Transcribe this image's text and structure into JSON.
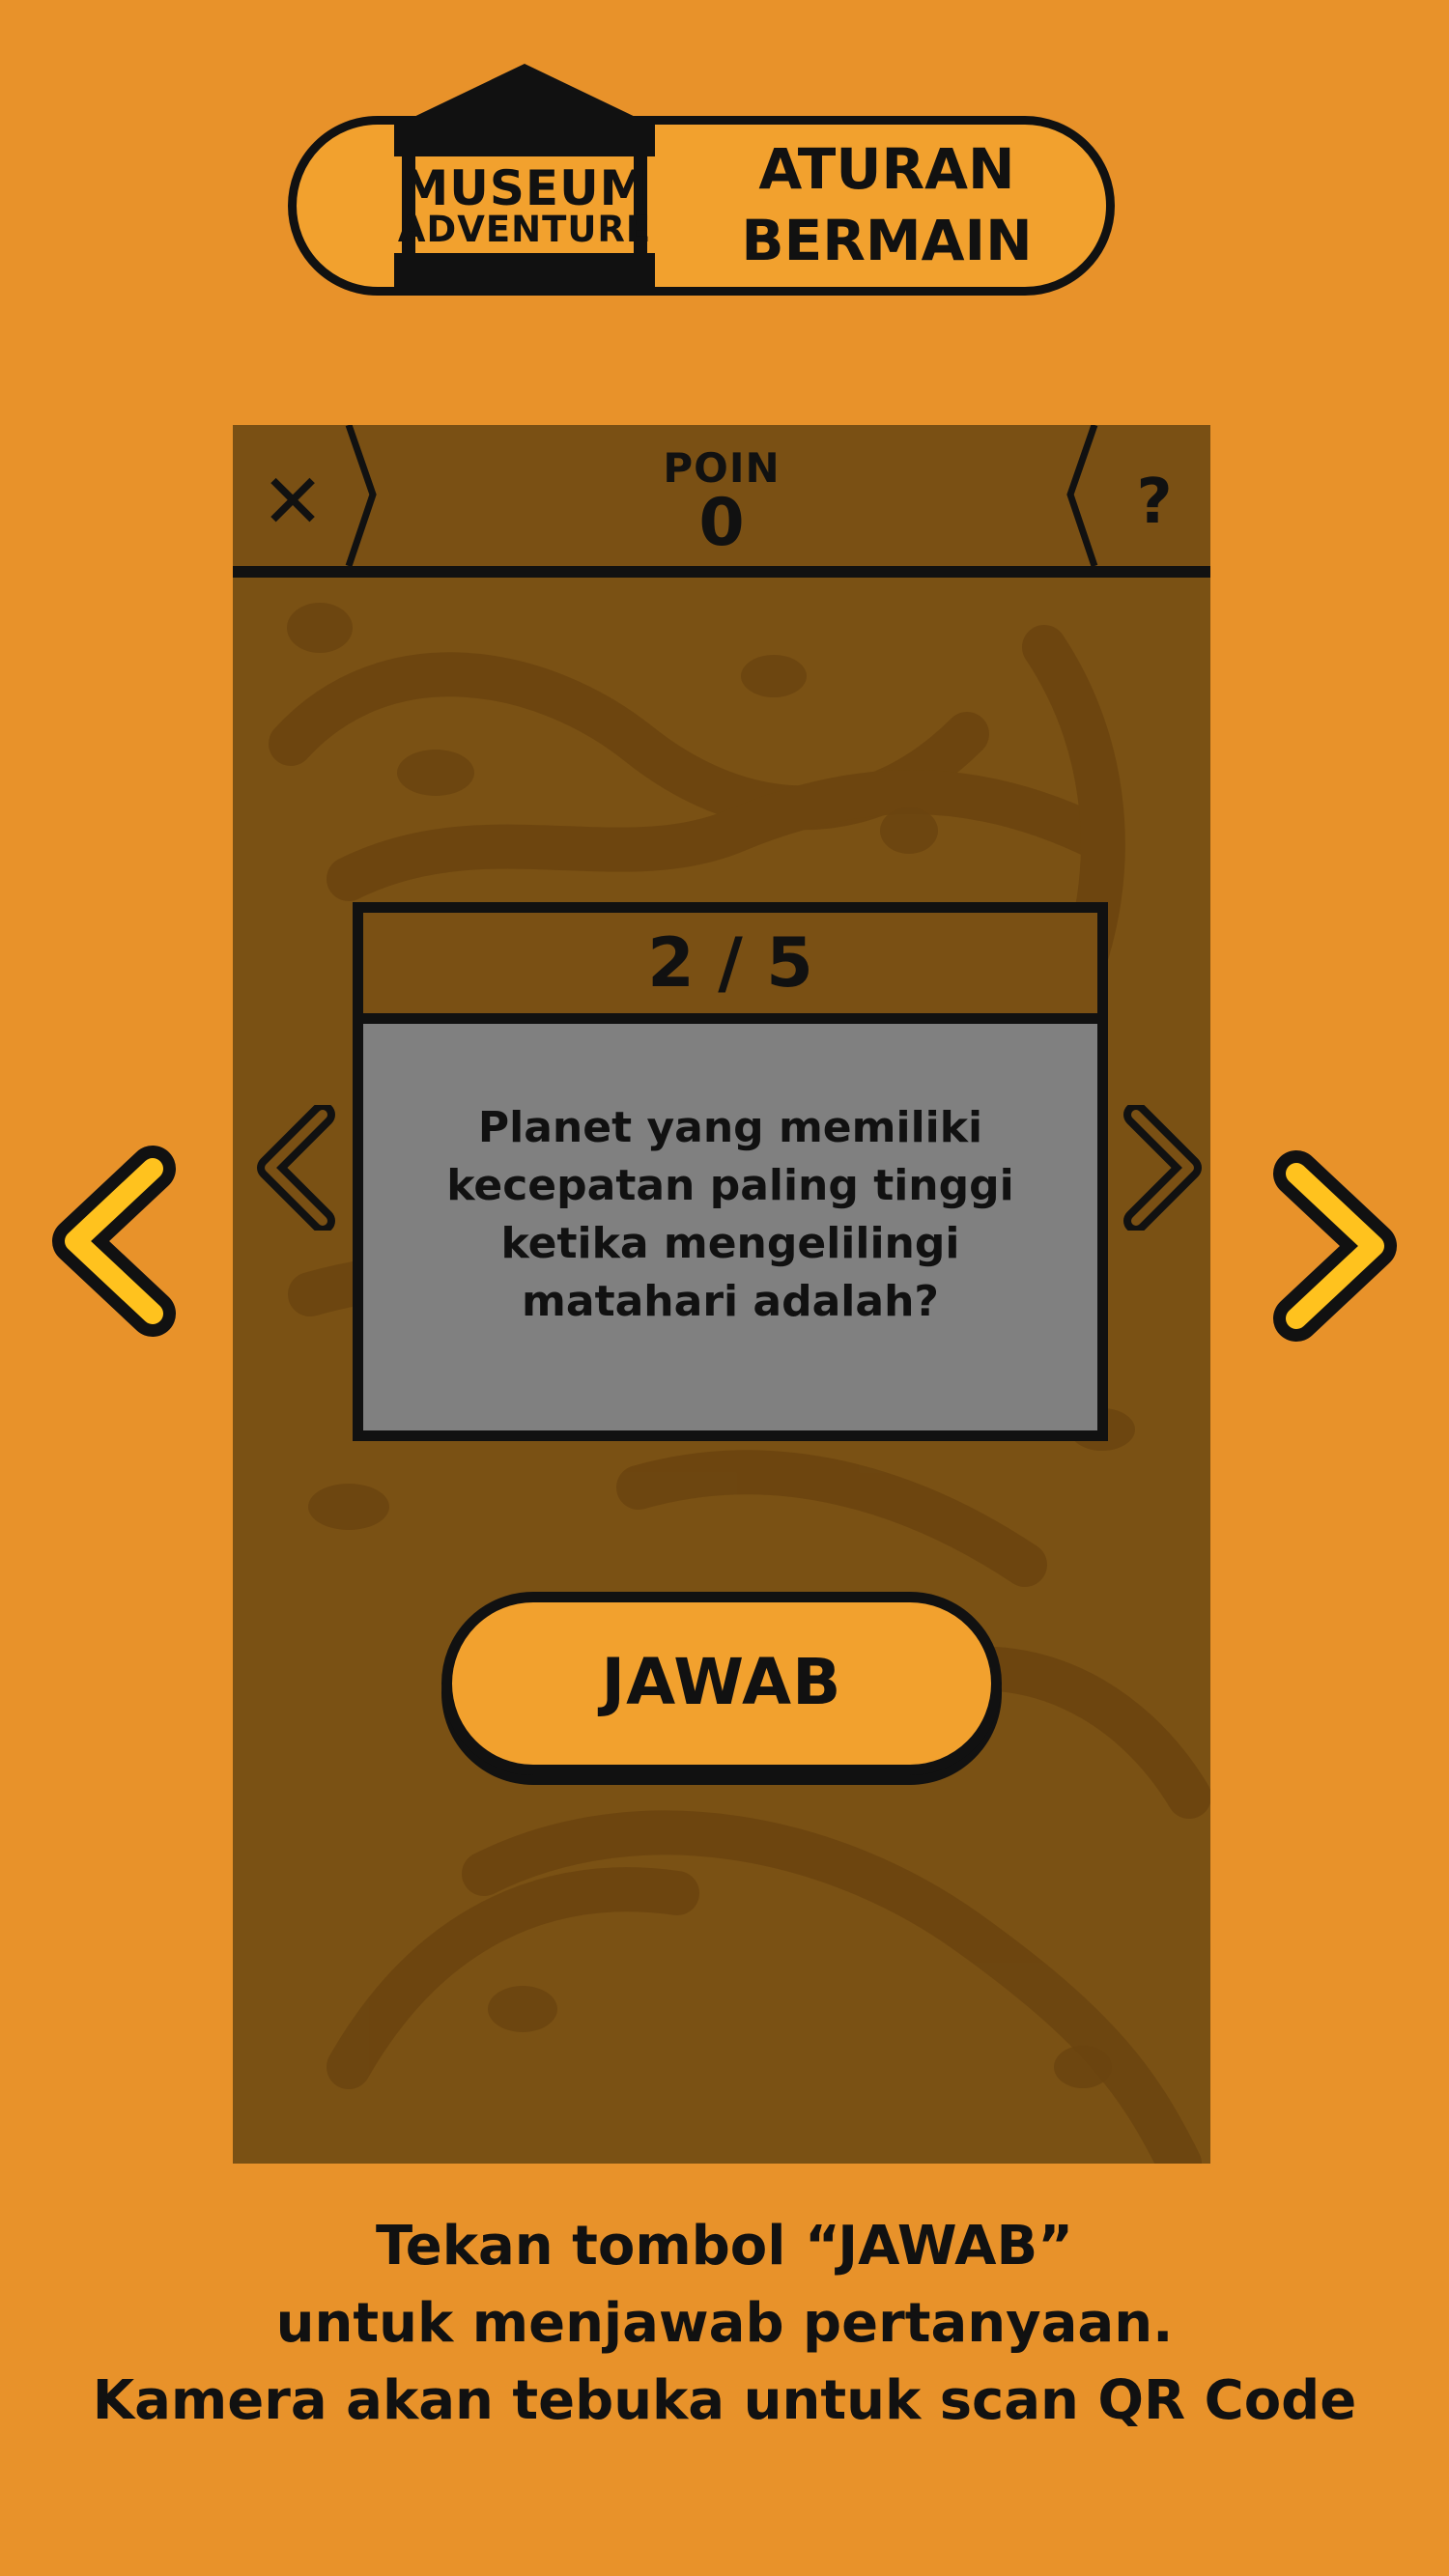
{
  "header": {
    "logo_line1": "MUSEUM",
    "logo_line2": "ADVENTURE",
    "title_line1": "ATURAN",
    "title_line2": "BERMAIN"
  },
  "game": {
    "points_label": "POIN",
    "points_value": "0",
    "close_icon": "close-icon",
    "help_label": "?",
    "question_counter": "2 / 5",
    "question_text": "Planet yang memiliki kecepatan paling tinggi ketika mengelilingi matahari adalah?",
    "answer_button": "JAWAB"
  },
  "caption": {
    "line1": "Tekan tombol “JAWAB”",
    "line2": "untuk menjawab pertanyaan.",
    "line3": "Kamera akan tebuka untuk scan QR Code"
  },
  "colors": {
    "background": "#E8922A",
    "accent": "#F2A12E",
    "phone_bg": "#7A5114",
    "card_body": "#808080",
    "outline": "#111111"
  }
}
